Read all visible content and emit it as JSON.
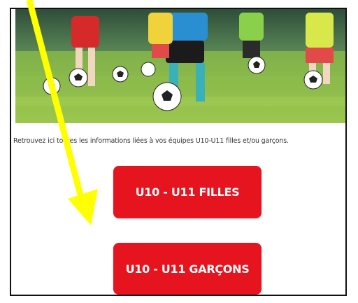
{
  "intro_text": "Retrouvez ici toutes les informations liées à vos équipes U10-U11 filles et/ou garçons.",
  "buttons": {
    "filles_label": "U10 - U11 FILLES",
    "garcons_label": "U10 - U11 GARÇONS"
  },
  "colors": {
    "button_red": "#e5141f",
    "annotation_arrow": "#ffff00"
  },
  "hero_image": "children-playing-football-on-grass-photo",
  "annotation": "yellow-arrow-pointing-down-left"
}
